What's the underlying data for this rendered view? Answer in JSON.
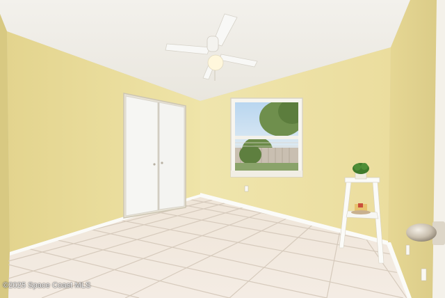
{
  "watermark": {
    "text": "©2025 Space Coast MLS"
  },
  "colors": {
    "ceiling": "#f1efea",
    "wall_left": "#e9dc9b",
    "wall_back": "#efe3a6",
    "wall_right": "#e6d897",
    "floor_tile": "#efe6dc",
    "grout": "#d3c7b8",
    "baseboard": "#ffffff",
    "closet_door": "#f7f7f5"
  },
  "icons": {
    "ceiling_fan": "ceiling-fan-icon",
    "potted_plant": "potted-plant-icon",
    "door_knob": "door-knob-icon"
  }
}
